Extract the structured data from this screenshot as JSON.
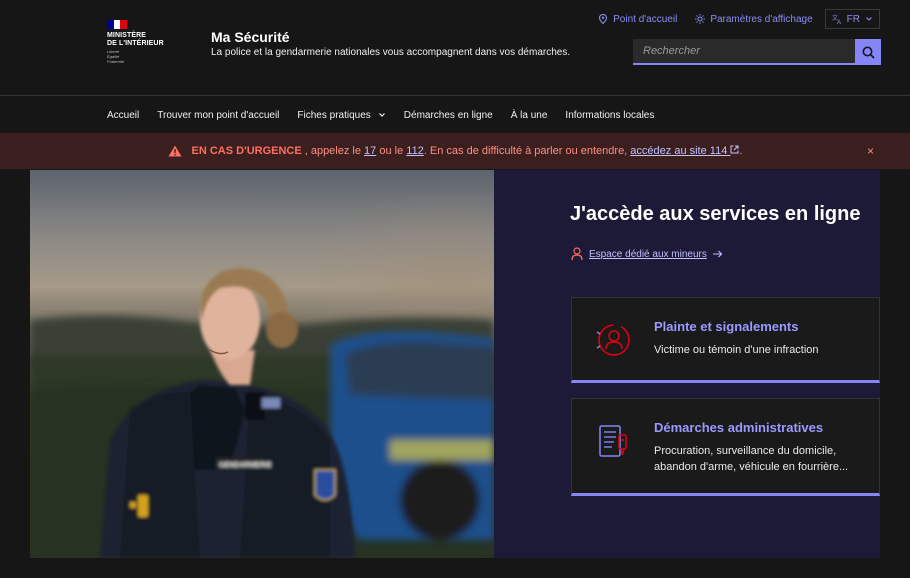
{
  "header": {
    "logo": {
      "title_line1": "MINISTÈRE",
      "title_line2": "DE L'INTÉRIEUR",
      "motto": [
        "Liberté",
        "Égalité",
        "Fraternité"
      ],
      "flag_colors": [
        "#000091",
        "#ffffff",
        "#e1000f"
      ]
    },
    "site_title": "Ma Sécurité",
    "tagline": "La police et la gendarmerie nationales vous accompagnent dans vos démarches.",
    "tools": {
      "point_accueil": "Point d'accueil",
      "display_settings": "Paramètres d'affichage",
      "language": "FR"
    },
    "search": {
      "placeholder": "Rechercher"
    }
  },
  "nav": {
    "items": [
      {
        "label": "Accueil"
      },
      {
        "label": "Trouver mon point d'accueil"
      },
      {
        "label": "Fiches pratiques",
        "has_dropdown": true
      },
      {
        "label": "Démarches en ligne"
      },
      {
        "label": "À la une"
      },
      {
        "label": "Informations locales"
      }
    ]
  },
  "alert": {
    "emphasis": "EN CAS D'URGENCE",
    "text1": ", appelez le ",
    "num1": "17",
    "text2": " ou le ",
    "num2": "112",
    "text3": ". En cas de difficulté à parler ou entendre, ",
    "link": "accédez au site 114",
    "text4": ".",
    "close": "×"
  },
  "hero": {
    "title": "J'accède aux services en ligne",
    "minor_link": "Espace dédié aux mineurs",
    "cards": [
      {
        "title": "Plainte et signalements",
        "desc": "Victime ou témoin d'une infraction",
        "icon": "complaint-icon"
      },
      {
        "title": "Démarches administratives",
        "desc": "Procuration, surveillance du domicile, abandon d'arme, véhicule en fourrière...",
        "icon": "admin-form-icon"
      }
    ]
  },
  "colors": {
    "accent": "#8585f6",
    "alert_bg": "#3b1e1e",
    "alert_text": "#ff6f63",
    "hero_bg": "#1c1a36"
  }
}
